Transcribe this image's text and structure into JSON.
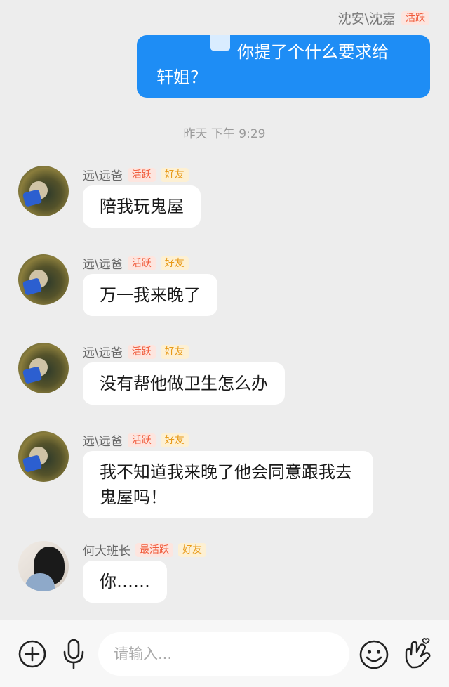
{
  "outgoing": {
    "sender": "沈安\\沈嘉",
    "badge": "活跃",
    "line1": "你提了个什么要求给",
    "line2": "轩姐？"
  },
  "timestamp": "昨天 下午 9:29",
  "messages": [
    {
      "name": "远\\远爸",
      "badges": [
        "活跃",
        "好友"
      ],
      "text": "陪我玩鬼屋"
    },
    {
      "name": "远\\远爸",
      "badges": [
        "活跃",
        "好友"
      ],
      "text": "万一我来晚了"
    },
    {
      "name": "远\\远爸",
      "badges": [
        "活跃",
        "好友"
      ],
      "text": "没有帮他做卫生怎么办"
    },
    {
      "name": "远\\远爸",
      "badges": [
        "活跃",
        "好友"
      ],
      "text": "我不知道我来晚了他会同意跟我去鬼屋吗！"
    },
    {
      "name": "何大班长",
      "badges": [
        "最活跃",
        "好友"
      ],
      "text": "你……"
    }
  ],
  "input": {
    "placeholder": "请输入..."
  },
  "icons": {
    "add": "plus-circle-icon",
    "voice": "microphone-icon",
    "emoji": "smiley-icon",
    "gesture": "finger-heart-icon"
  },
  "colors": {
    "outgoing_bubble": "#1e8df5",
    "active_badge": "#f05a3a",
    "friend_badge": "#e89a18"
  }
}
